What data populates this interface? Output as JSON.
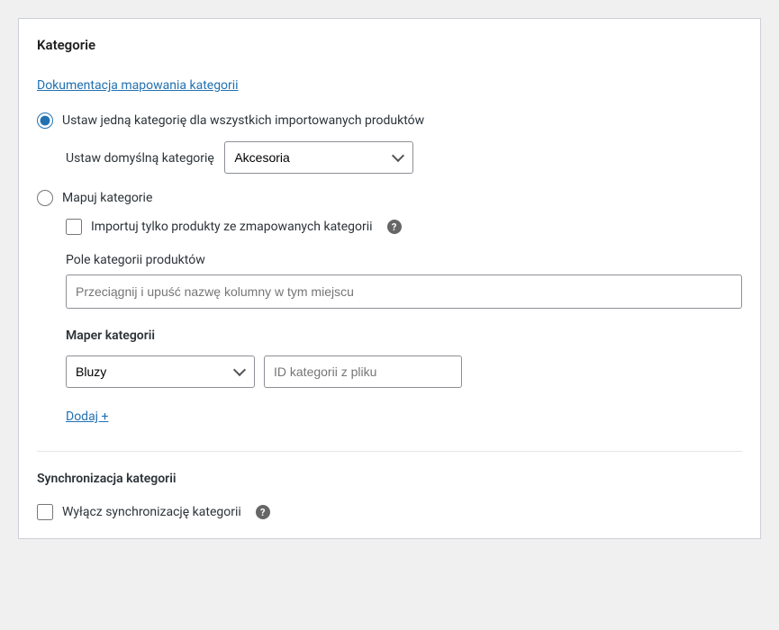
{
  "panel": {
    "title": "Kategorie",
    "docLink": "Dokumentacja mapowania kategorii"
  },
  "options": {
    "singleCategory": {
      "label": "Ustaw jedną kategorię dla wszystkich importowanych produktów",
      "defaultLabel": "Ustaw domyślną kategorię",
      "selected": "Akcesoria"
    },
    "mapCategories": {
      "label": "Mapuj kategorie",
      "importOnlyMapped": "Importuj tylko produkty ze zmapowanych kategorii",
      "productCategoryFieldLabel": "Pole kategorii produktów",
      "productCategoryPlaceholder": "Przeciągnij i upuść nazwę kolumny w tym miejscu",
      "mapperLabel": "Maper kategorii",
      "mapperSelect": "Bluzy",
      "mapperInputPlaceholder": "ID kategorii z pliku",
      "addLink": "Dodaj +"
    }
  },
  "sync": {
    "title": "Synchronizacja kategorii",
    "disableLabel": "Wyłącz synchronizację kategorii"
  }
}
